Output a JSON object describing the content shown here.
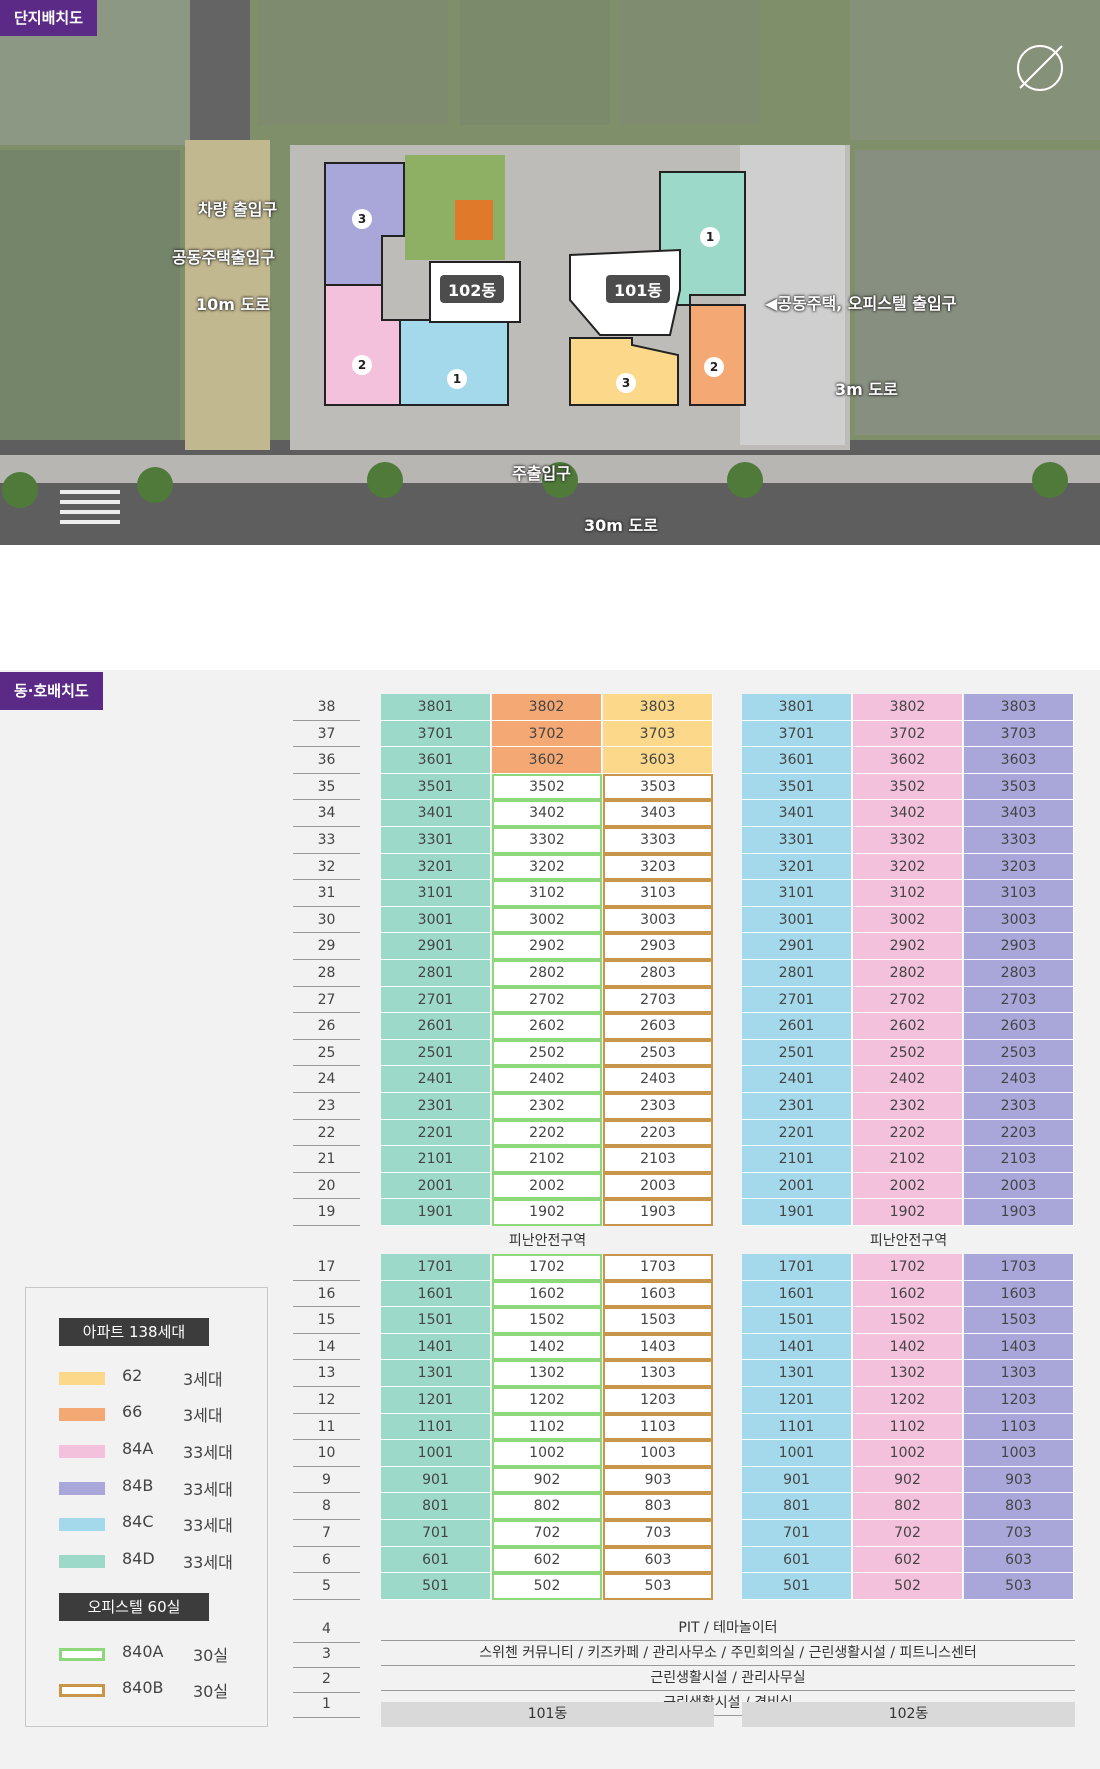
{
  "site": {
    "tag": "단지배치도",
    "labels": {
      "vehicle_entrance": "차량 출입구",
      "housing_entrance": "공동주택출입구",
      "road_10m": "10m 도로",
      "housing_office_entrance": "◀공동주택, 오피스텔 출입구",
      "road_3m": "3m 도로",
      "main_entrance": "주출입구",
      "road_30m": "30m 도로",
      "dong101": "101동",
      "dong102": "102동"
    },
    "numbers": [
      "3",
      "1",
      "2",
      "1",
      "2",
      "3"
    ]
  },
  "units": {
    "tag": "동·호배치도",
    "colors": {
      "type62": "#fcd98a",
      "type66": "#f4a874",
      "type84A": "#f4c1dc",
      "type84B": "#a9a6da",
      "type84C": "#a4d9ec",
      "type84D": "#9dd9c9",
      "op840A": "#8cd87a",
      "op840B": "#c8964a"
    },
    "refuge_label": "피난안전구역",
    "commons": [
      {
        "floor": "4",
        "text": "PIT / 테마놀이터"
      },
      {
        "floor": "3",
        "text": "스위첸 커뮤니티 / 키즈카페 / 관리사무소 / 주민회의실 / 근린생활시설 / 피트니스센터"
      },
      {
        "floor": "2",
        "text": "근린생활시설 / 관리사무실"
      },
      {
        "floor": "1",
        "text": "근린생활시설 / 경비실"
      }
    ],
    "dong_labels": [
      "101동",
      "102동"
    ]
  },
  "legend": {
    "apartment_title": "아파트 138세대",
    "apartments": [
      {
        "type": "62",
        "count": "3세대",
        "color": "#fcd98a"
      },
      {
        "type": "66",
        "count": "3세대",
        "color": "#f4a874"
      },
      {
        "type": "84A",
        "count": "33세대",
        "color": "#f4c1dc"
      },
      {
        "type": "84B",
        "count": "33세대",
        "color": "#a9a6da"
      },
      {
        "type": "84C",
        "count": "33세대",
        "color": "#a4d9ec"
      },
      {
        "type": "84D",
        "count": "33세대",
        "color": "#9dd9c9"
      }
    ],
    "officetel_title": "오피스텔 60실",
    "officetels": [
      {
        "type": "840A",
        "count": "30실",
        "color": "#8cd87a"
      },
      {
        "type": "840B",
        "count": "30실",
        "color": "#c8964a"
      }
    ]
  }
}
